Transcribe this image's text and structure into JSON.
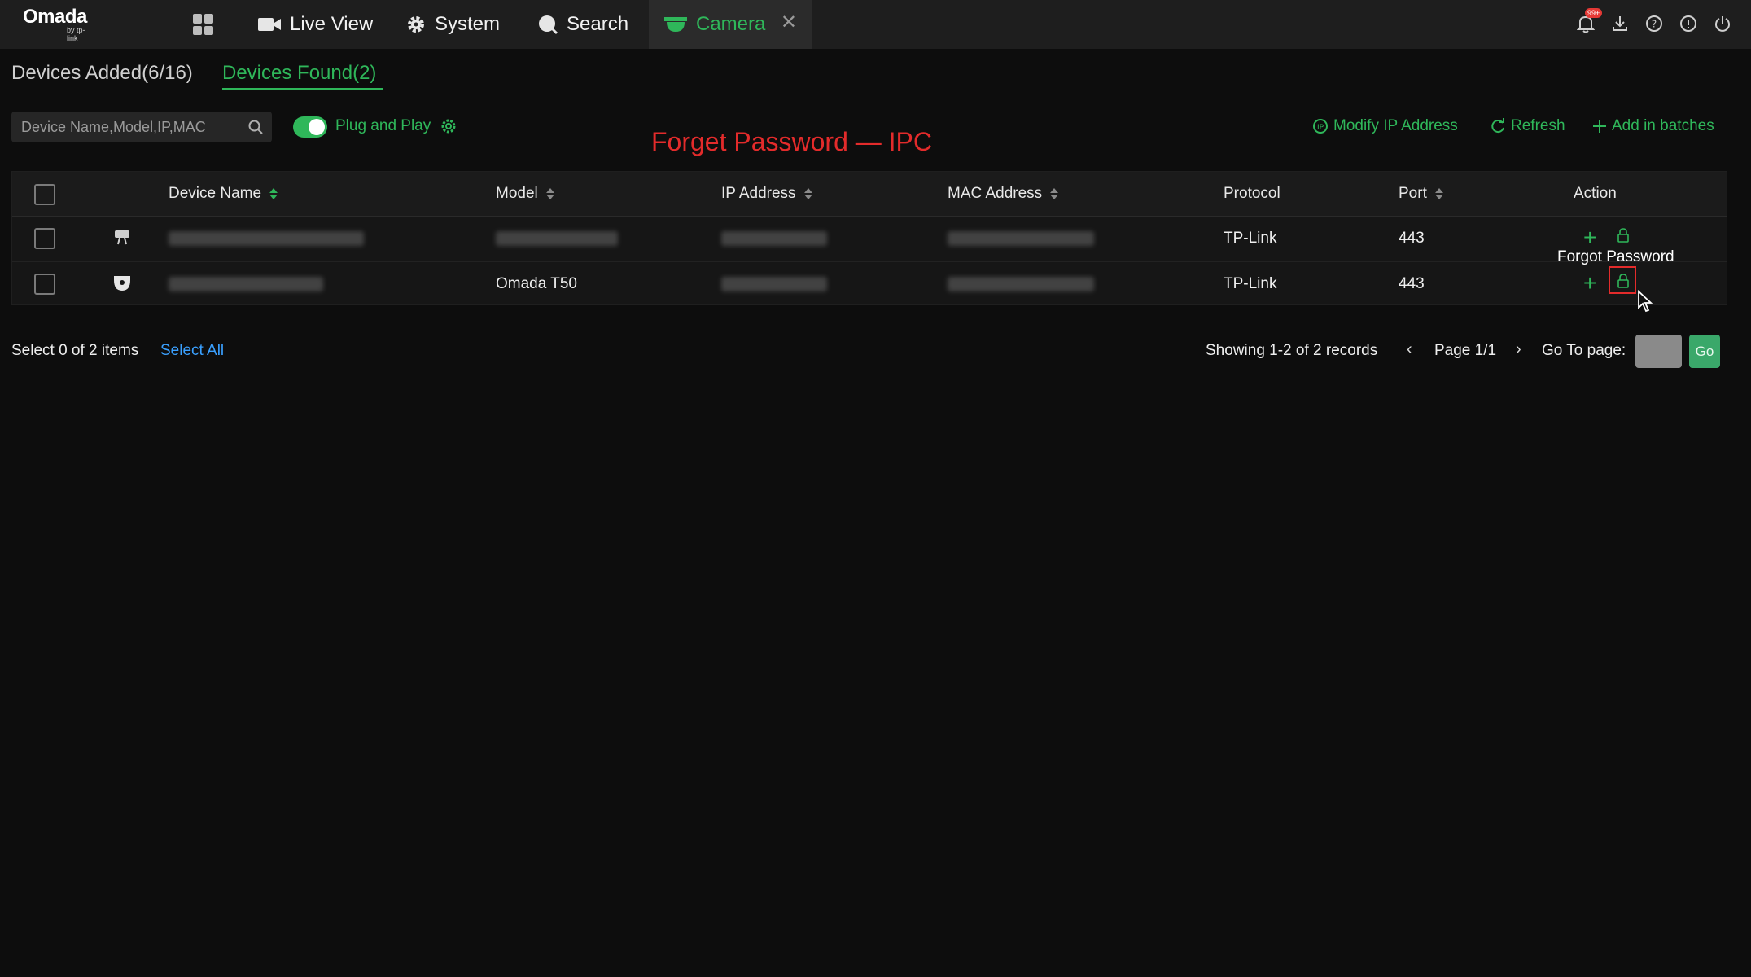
{
  "app": {
    "logo_main": "Omada",
    "logo_sub": "by tp-link"
  },
  "nav": {
    "live_view": "Live View",
    "system": "System",
    "search": "Search",
    "camera": "Camera",
    "close_glyph": "✕"
  },
  "notifications": {
    "badge": "99+"
  },
  "tabs": {
    "added": "Devices Added(6/16)",
    "found": "Devices Found(2)"
  },
  "toolbar": {
    "search_placeholder": "Device Name,Model,IP,MAC",
    "plug_and_play": "Plug and Play",
    "plug_and_play_on": true,
    "modify_ip": "Modify IP Address",
    "refresh": "Refresh",
    "add_in_batches": "Add in batches"
  },
  "overlay_title": "Forget Password — IPC",
  "table": {
    "headers": {
      "device_name": "Device Name",
      "model": "Model",
      "ip": "IP Address",
      "mac": "MAC Address",
      "protocol": "Protocol",
      "port": "Port",
      "action": "Action"
    },
    "rows": [
      {
        "icon": "bullet-camera-icon",
        "model": "",
        "protocol": "TP-Link",
        "port": "443"
      },
      {
        "icon": "dome-camera-icon",
        "model": "Omada T50",
        "protocol": "TP-Link",
        "port": "443"
      }
    ]
  },
  "tooltip": "Forgot Password",
  "footer": {
    "selection": "Select 0 of 2 items",
    "select_all": "Select All",
    "showing": "Showing 1-2 of 2 records",
    "prev": "‹",
    "page": "Page 1/1",
    "next": "›",
    "goto_label": "Go To page:",
    "go": "Go"
  },
  "colors": {
    "accent": "#2fb75a",
    "highlight": "#e32b2b",
    "link": "#3aa0ff"
  }
}
